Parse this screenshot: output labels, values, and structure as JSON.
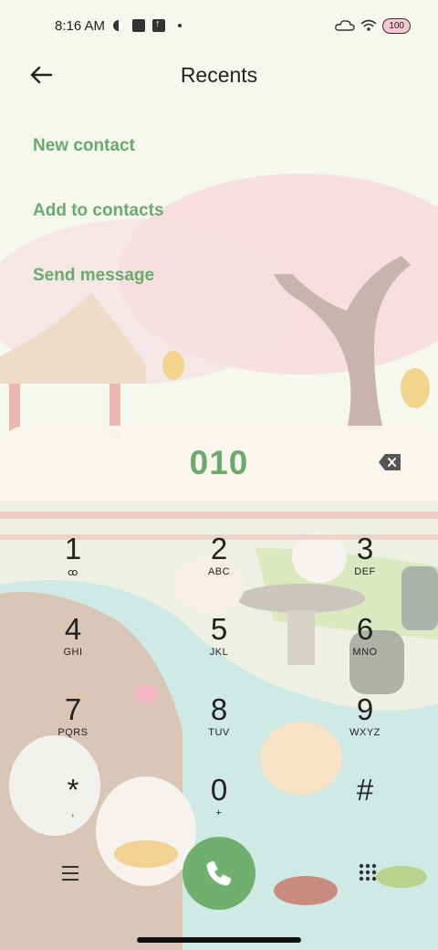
{
  "status_bar": {
    "time": "8:16 AM",
    "battery": "100",
    "icons": [
      "app-icon",
      "stop-square-icon",
      "upload-icon",
      "dot-icon",
      "cloud-icon",
      "wifi-icon",
      "battery-icon"
    ]
  },
  "header": {
    "title": "Recents",
    "back_icon": "arrow-left-icon"
  },
  "actions": [
    {
      "label": "New contact"
    },
    {
      "label": "Add to contacts"
    },
    {
      "label": "Send message"
    }
  ],
  "dialer": {
    "number": "010",
    "backspace_icon": "backspace-icon"
  },
  "keypad": [
    {
      "digit": "1",
      "letters": "ꝏ"
    },
    {
      "digit": "2",
      "letters": "ABC"
    },
    {
      "digit": "3",
      "letters": "DEF"
    },
    {
      "digit": "4",
      "letters": "GHI"
    },
    {
      "digit": "5",
      "letters": "JKL"
    },
    {
      "digit": "6",
      "letters": "MNO"
    },
    {
      "digit": "7",
      "letters": "PQRS"
    },
    {
      "digit": "8",
      "letters": "TUV"
    },
    {
      "digit": "9",
      "letters": "WXYZ"
    },
    {
      "digit": "*",
      "letters": ","
    },
    {
      "digit": "0",
      "letters": "+"
    },
    {
      "digit": "#",
      "letters": ""
    }
  ],
  "bottom": {
    "menu_icon": "menu-icon",
    "call_icon": "phone-icon",
    "dialpad_icon": "dialpad-icon",
    "call_color": "#6fb06f"
  },
  "colors": {
    "accent": "#6aaa6a",
    "panel": "#faf5ec"
  }
}
